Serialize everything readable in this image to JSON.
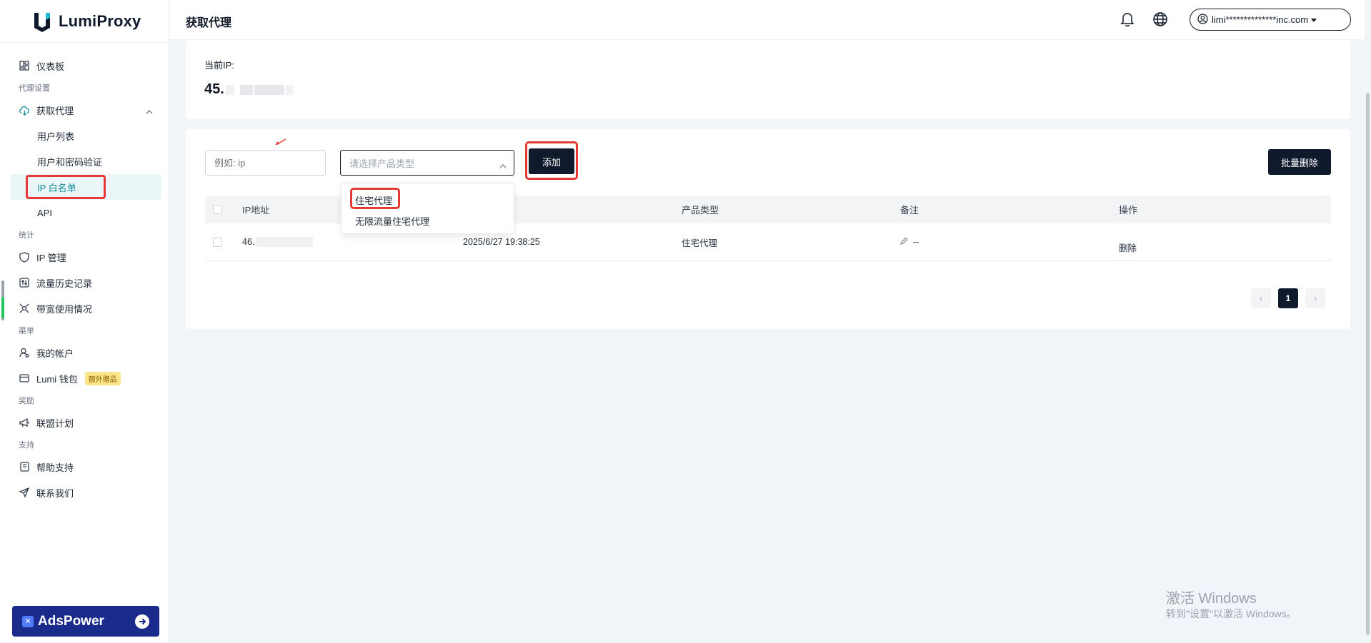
{
  "brand": {
    "name": "LumiProxy"
  },
  "header": {
    "title": "获取代理",
    "account": "limi**************inc.com"
  },
  "sidebar": {
    "dashboard": "仪表板",
    "section_proxy": "代理设置",
    "get_proxy": "获取代理",
    "sub_users": "用户列表",
    "sub_userpass": "用户和密码验证",
    "sub_whitelist": "IP 白名单",
    "sub_api": "API",
    "section_stats": "统计",
    "ip_manage": "IP 管理",
    "traffic_history": "流量历史记录",
    "bandwidth": "带宽使用情况",
    "section_menu": "菜单",
    "my_account": "我的帐户",
    "wallet": "Lumi 钱包",
    "wallet_badge": "额外赠品",
    "section_rewards": "奖励",
    "affiliate": "联盟计划",
    "section_support": "支持",
    "help": "帮助支持",
    "contact": "联系我们"
  },
  "ads": {
    "label": "AdsPower"
  },
  "current_ip": {
    "label": "当前IP:",
    "value_prefix": "45."
  },
  "form": {
    "ip_placeholder": "例如: ip",
    "product_placeholder": "请选择产品类型",
    "add_label": "添加",
    "bulk_delete_label": "批量删除"
  },
  "dropdown": {
    "options": [
      "住宅代理",
      "无限流量住宅代理"
    ]
  },
  "table": {
    "headers": [
      "IP地址",
      "产品类型",
      "备注",
      "操作"
    ],
    "rows": [
      {
        "ip_prefix": "46.",
        "time": "2025/6/27 19:38:25",
        "product": "住宅代理",
        "note": "--",
        "action": "删除"
      }
    ]
  },
  "pagination": {
    "current": "1"
  },
  "watermark": {
    "line1": "激活 Windows",
    "line2": "转到\"设置\"以激活 Windows。"
  }
}
